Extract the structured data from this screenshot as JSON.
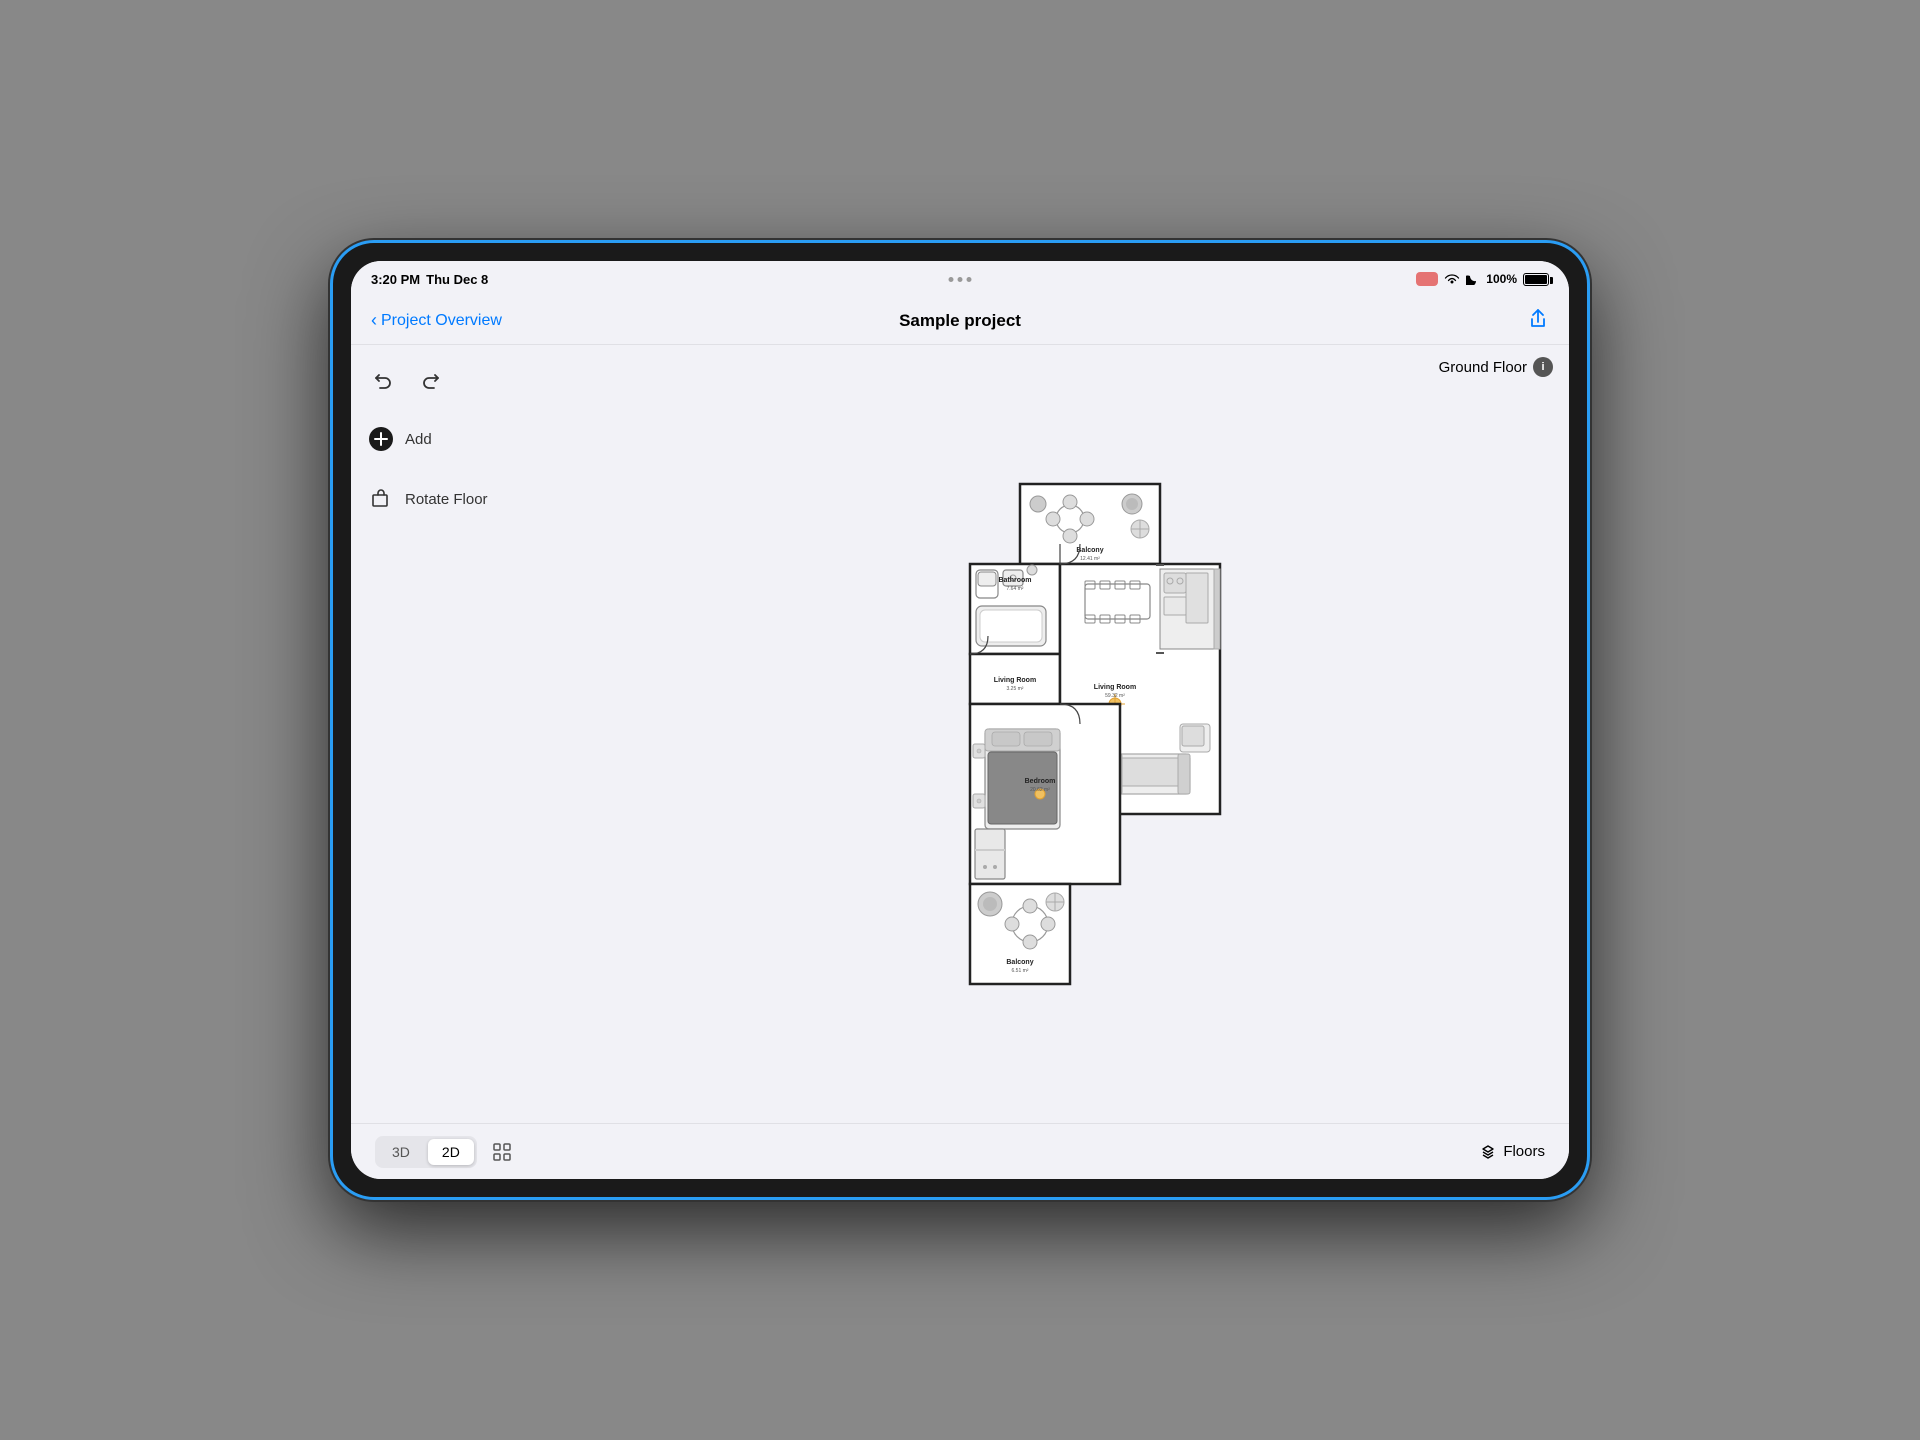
{
  "status_bar": {
    "time": "3:20 PM",
    "date": "Thu Dec 8",
    "wifi": "WiFi",
    "battery": "100%",
    "ellipsis": "···"
  },
  "nav": {
    "back_label": "Project Overview",
    "title": "Sample project",
    "share_icon": "share-icon"
  },
  "sidebar": {
    "undo_icon": "undo-icon",
    "redo_icon": "redo-icon",
    "add_label": "Add",
    "add_icon": "add-icon",
    "rotate_label": "Rotate Floor",
    "rotate_icon": "rotate-icon"
  },
  "floorplan": {
    "floor_label": "Ground Floor",
    "rooms": [
      {
        "name": "Balcony",
        "size": "12.41 m²",
        "id": "balcony-top"
      },
      {
        "name": "Bathroom",
        "size": "7.64 m²",
        "id": "bathroom"
      },
      {
        "name": "Living Room",
        "size": "3.25 m²",
        "id": "living-room-small"
      },
      {
        "name": "Living Room",
        "size": "59.32 m²",
        "id": "living-room-main"
      },
      {
        "name": "Bedroom",
        "size": "20.62 m²",
        "id": "bedroom"
      },
      {
        "name": "Balcony",
        "size": "6.51 m²",
        "id": "balcony-bottom"
      }
    ]
  },
  "bottom_toolbar": {
    "view_3d": "3D",
    "view_2d": "2D",
    "floors_label": "Floors"
  }
}
